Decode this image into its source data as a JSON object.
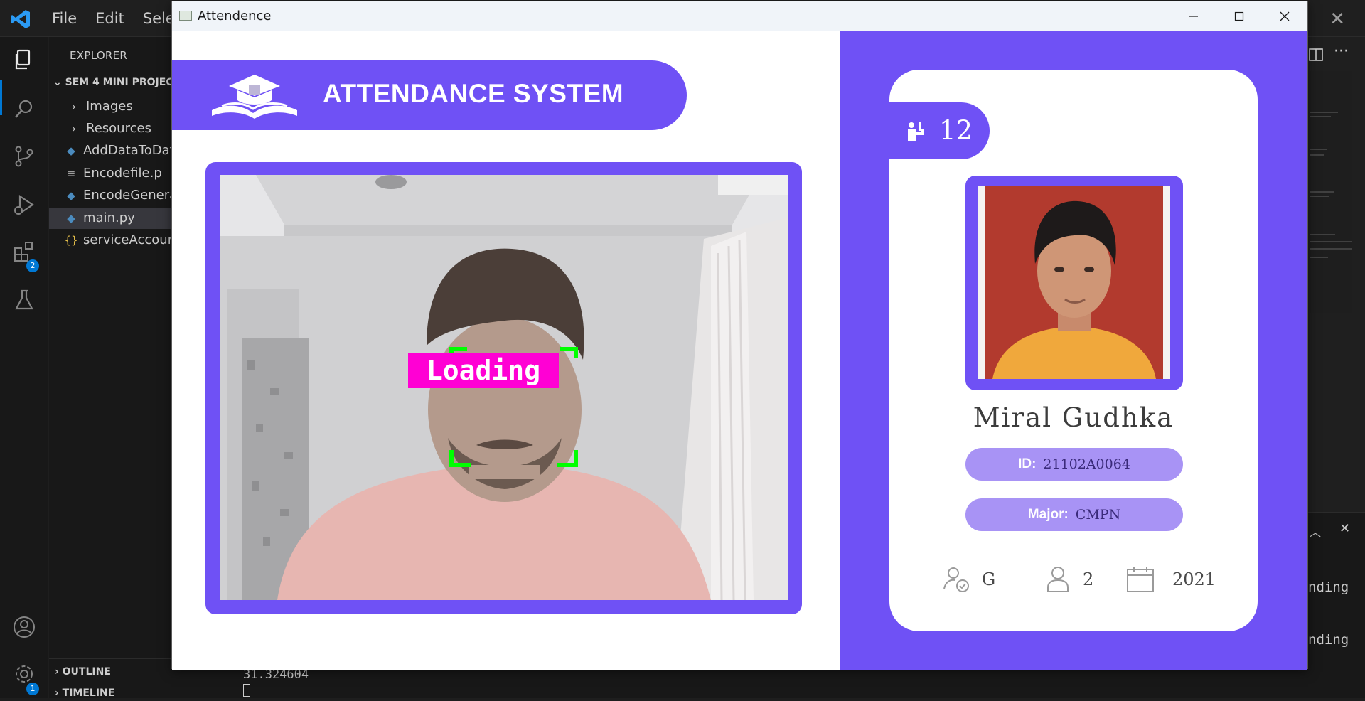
{
  "vscode": {
    "menu": [
      "File",
      "Edit",
      "Sele"
    ],
    "explorer_title": "EXPLORER",
    "folder": "SEM 4 MINI PROJEC",
    "files": [
      {
        "label": "Images",
        "type": "folder"
      },
      {
        "label": "Resources",
        "type": "folder"
      },
      {
        "label": "AddDataToData",
        "type": "python"
      },
      {
        "label": "Encodefile.p",
        "type": "text"
      },
      {
        "label": "EncodeGenerat",
        "type": "python"
      },
      {
        "label": "main.py",
        "type": "python",
        "selected": true
      },
      {
        "label": "serviceAccount",
        "type": "json"
      }
    ],
    "outline": "OUTLINE",
    "timeline": "TIMELINE",
    "extensions_badge": "2",
    "settings_badge": "1",
    "terminal_value": "31.324604",
    "panel_text_1": "nding",
    "panel_text_2": "nding"
  },
  "window": {
    "title": "Attendence"
  },
  "app": {
    "header_title": "ATTENDANCE SYSTEM",
    "camera_status": "Loading",
    "total_attendance": "12",
    "student_name": "Miral Gudhka",
    "id_label": "ID:",
    "id_value": "21102A0064",
    "major_label": "Major:",
    "major_value": "CMPN",
    "standing": "G",
    "year": "2",
    "starting_year": "2021"
  },
  "colors": {
    "accent": "#6f51f5",
    "pill": "#a893f5",
    "loading_bg": "#ff00d4",
    "face_box": "#00ff00"
  }
}
